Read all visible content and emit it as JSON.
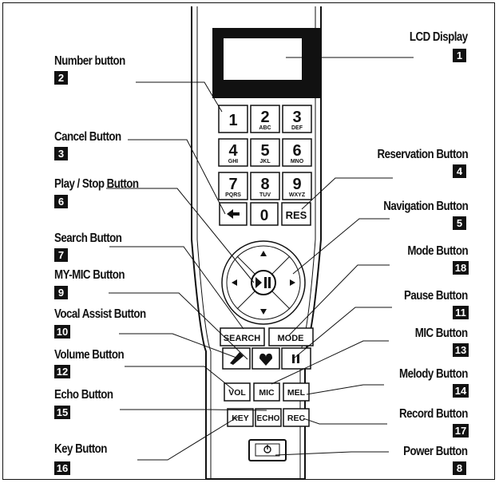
{
  "callouts": [
    {
      "id": "lcd",
      "label": "LCD Display",
      "num": "1"
    },
    {
      "id": "number",
      "label": "Number button",
      "num": "2"
    },
    {
      "id": "cancel",
      "label": "Cancel Button",
      "num": "3"
    },
    {
      "id": "reservation",
      "label": "Reservation Button",
      "num": "4"
    },
    {
      "id": "play",
      "label": "Play / Stop Button",
      "num": "6"
    },
    {
      "id": "navigation",
      "label": "Navigation Button",
      "num": "5"
    },
    {
      "id": "search",
      "label": "Search Button",
      "num": "7"
    },
    {
      "id": "mode",
      "label": "Mode Button",
      "num": "18"
    },
    {
      "id": "mymic",
      "label": "MY-MIC Button",
      "num": "9"
    },
    {
      "id": "pause",
      "label": "Pause Button",
      "num": "11"
    },
    {
      "id": "vocal",
      "label": "Vocal Assist  Button",
      "num": "10"
    },
    {
      "id": "mic",
      "label": "MIC Button",
      "num": "13"
    },
    {
      "id": "volume",
      "label": "Volume Button",
      "num": "12"
    },
    {
      "id": "melody",
      "label": "Melody Button",
      "num": "14"
    },
    {
      "id": "echo",
      "label": "Echo Button",
      "num": "15"
    },
    {
      "id": "record",
      "label": "Record Button",
      "num": "17"
    },
    {
      "id": "key",
      "label": "Key Button",
      "num": "16"
    },
    {
      "id": "power",
      "label": "Power Button",
      "num": "8"
    }
  ],
  "keys": {
    "digits": [
      {
        "d": "1",
        "sub": ""
      },
      {
        "d": "2",
        "sub": "ABC"
      },
      {
        "d": "3",
        "sub": "DEF"
      },
      {
        "d": "4",
        "sub": "GHI"
      },
      {
        "d": "5",
        "sub": "JKL"
      },
      {
        "d": "6",
        "sub": "MNO"
      },
      {
        "d": "7",
        "sub": "PQRS"
      },
      {
        "d": "8",
        "sub": "TUV"
      },
      {
        "d": "9",
        "sub": "WXYZ"
      }
    ],
    "zero": "0",
    "res": "RES",
    "search": "SEARCH",
    "mode": "MODE",
    "vol": "VOL",
    "mic": "MIC",
    "mel": "MEL",
    "key": "KEY",
    "echo": "ECHO",
    "rec": "REC"
  }
}
